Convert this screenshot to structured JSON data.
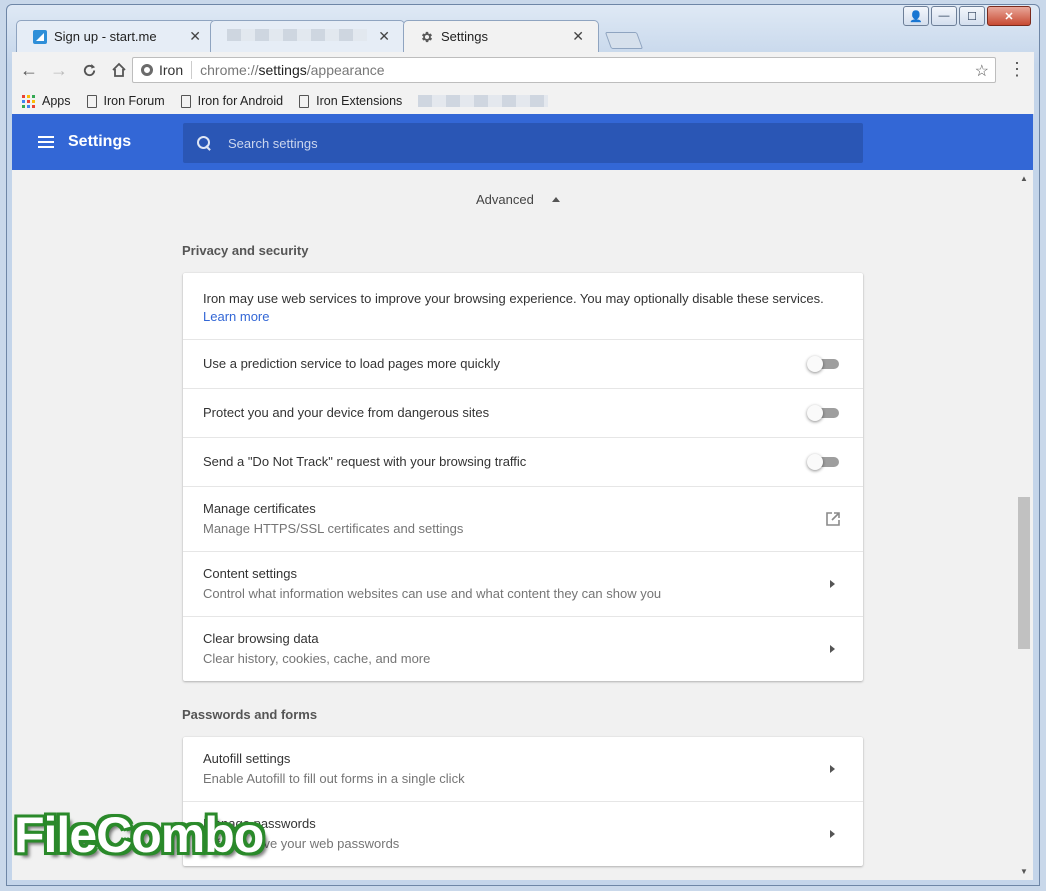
{
  "window": {
    "controls": {
      "user": "👤",
      "minimize": "—",
      "maximize": "☐",
      "close": "✕"
    }
  },
  "tabs": [
    {
      "title": "Sign up - start.me",
      "close": "✕",
      "icon": "start-me-icon"
    },
    {
      "title": "",
      "close": "✕",
      "icon": "blurred"
    },
    {
      "title": "Settings",
      "close": "✕",
      "icon": "gear-icon",
      "active": true
    }
  ],
  "toolbar": {
    "back": "←",
    "forward": "→",
    "reload": "C",
    "home": "⌂",
    "site_chip": "Iron",
    "url_scheme": "chrome://",
    "url_host": "settings",
    "url_path": "/appearance",
    "star": "☆",
    "menu": "⋮"
  },
  "bookmarks": [
    {
      "label": "Apps",
      "icon": "apps-grid-icon"
    },
    {
      "label": "Iron Forum",
      "icon": "page-icon"
    },
    {
      "label": "Iron for Android",
      "icon": "page-icon"
    },
    {
      "label": "Iron Extensions",
      "icon": "page-icon"
    }
  ],
  "header": {
    "title": "Settings",
    "search_placeholder": "Search settings",
    "color": "#3367d6"
  },
  "content": {
    "advanced_label": "Advanced",
    "privacy": {
      "title": "Privacy and security",
      "intro": "Iron may use web services to improve your browsing experience. You may optionally disable these services.",
      "learn_more": "Learn more",
      "rows": [
        {
          "primary": "Use a prediction service to load pages more quickly",
          "control": "toggle",
          "on": false
        },
        {
          "primary": "Protect you and your device from dangerous sites",
          "control": "toggle",
          "on": false
        },
        {
          "primary": "Send a \"Do Not Track\" request with your browsing traffic",
          "control": "toggle",
          "on": false
        },
        {
          "primary": "Manage certificates",
          "secondary": "Manage HTTPS/SSL certificates and settings",
          "control": "external-link-icon"
        },
        {
          "primary": "Content settings",
          "secondary": "Control what information websites can use and what content they can show you",
          "control": "chevron-right-icon"
        },
        {
          "primary": "Clear browsing data",
          "secondary": "Clear history, cookies, cache, and more",
          "control": "chevron-right-icon"
        }
      ]
    },
    "passwords": {
      "title": "Passwords and forms",
      "rows": [
        {
          "primary": "Autofill settings",
          "secondary": "Enable Autofill to fill out forms in a single click",
          "control": "chevron-right-icon"
        },
        {
          "primary": "Manage passwords",
          "secondary": "Offer to save your web passwords",
          "control": "chevron-right-icon"
        }
      ]
    }
  },
  "watermark": "FileCombo"
}
